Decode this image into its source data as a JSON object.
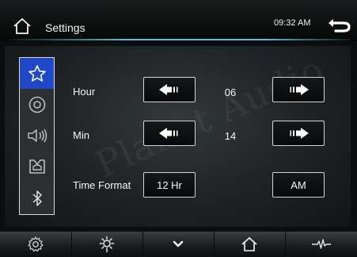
{
  "header": {
    "title": "Settings",
    "time": "09:32 AM",
    "home_icon": "home-icon",
    "back_icon": "back-arrow-icon"
  },
  "accent_color": "#56c2d6",
  "active_nav_color": "#1f49c9",
  "sidenav": {
    "items": [
      {
        "icon": "star-icon",
        "active": true
      },
      {
        "icon": "disc-icon",
        "active": false
      },
      {
        "icon": "speaker-volume-icon",
        "active": false
      },
      {
        "icon": "steering-wheel-control-icon",
        "active": false
      },
      {
        "icon": "bluetooth-icon",
        "active": false
      }
    ]
  },
  "settings": {
    "hour": {
      "label": "Hour",
      "value": "06"
    },
    "min": {
      "label": "Min",
      "value": "14"
    },
    "time_format": {
      "label": "Time Format",
      "value": "12 Hr",
      "ampm": "AM"
    }
  },
  "bottombar": {
    "items": [
      "gear-icon",
      "brightness-icon",
      "chevron-down-icon",
      "home-icon",
      "equalizer-icon"
    ]
  },
  "watermark": "Planet Audio"
}
